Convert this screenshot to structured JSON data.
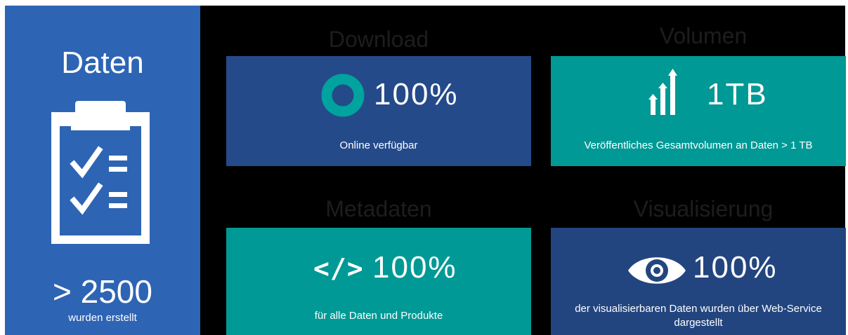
{
  "left": {
    "title": "Daten",
    "value": "> 2500",
    "subtitle": "wurden erstellt"
  },
  "download": {
    "title": "Download",
    "value": "100%",
    "description": "Online verfügbar"
  },
  "volumen": {
    "title": "Volumen",
    "value": "1TB",
    "description": "Veröffentliches Gesamtvolumen an Daten  > 1 TB"
  },
  "metadaten": {
    "title": "Metadaten",
    "icon_text": "</>",
    "value": "100%",
    "description": "für alle Daten und Produkte"
  },
  "visualisierung": {
    "title": "Visualisierung",
    "value": "100%",
    "description_line1": "der visualisierbaren Daten wurden über Web-Service",
    "description_line2": "dargestellt"
  },
  "icons": {
    "left": "clipboard-checklist-icon",
    "download": "donut-ring-icon",
    "volumen": "bar-growth-arrows-icon",
    "metadaten": "code-brackets-icon",
    "visualisierung": "eye-icon"
  },
  "colors": {
    "left_panel": "#2e64b4",
    "download_card": "#244a8a",
    "volumen_card": "#009995",
    "metadaten_card": "#009995",
    "visualisierung_card": "#23457f",
    "ring": "#00a39e",
    "background": "#000000"
  }
}
